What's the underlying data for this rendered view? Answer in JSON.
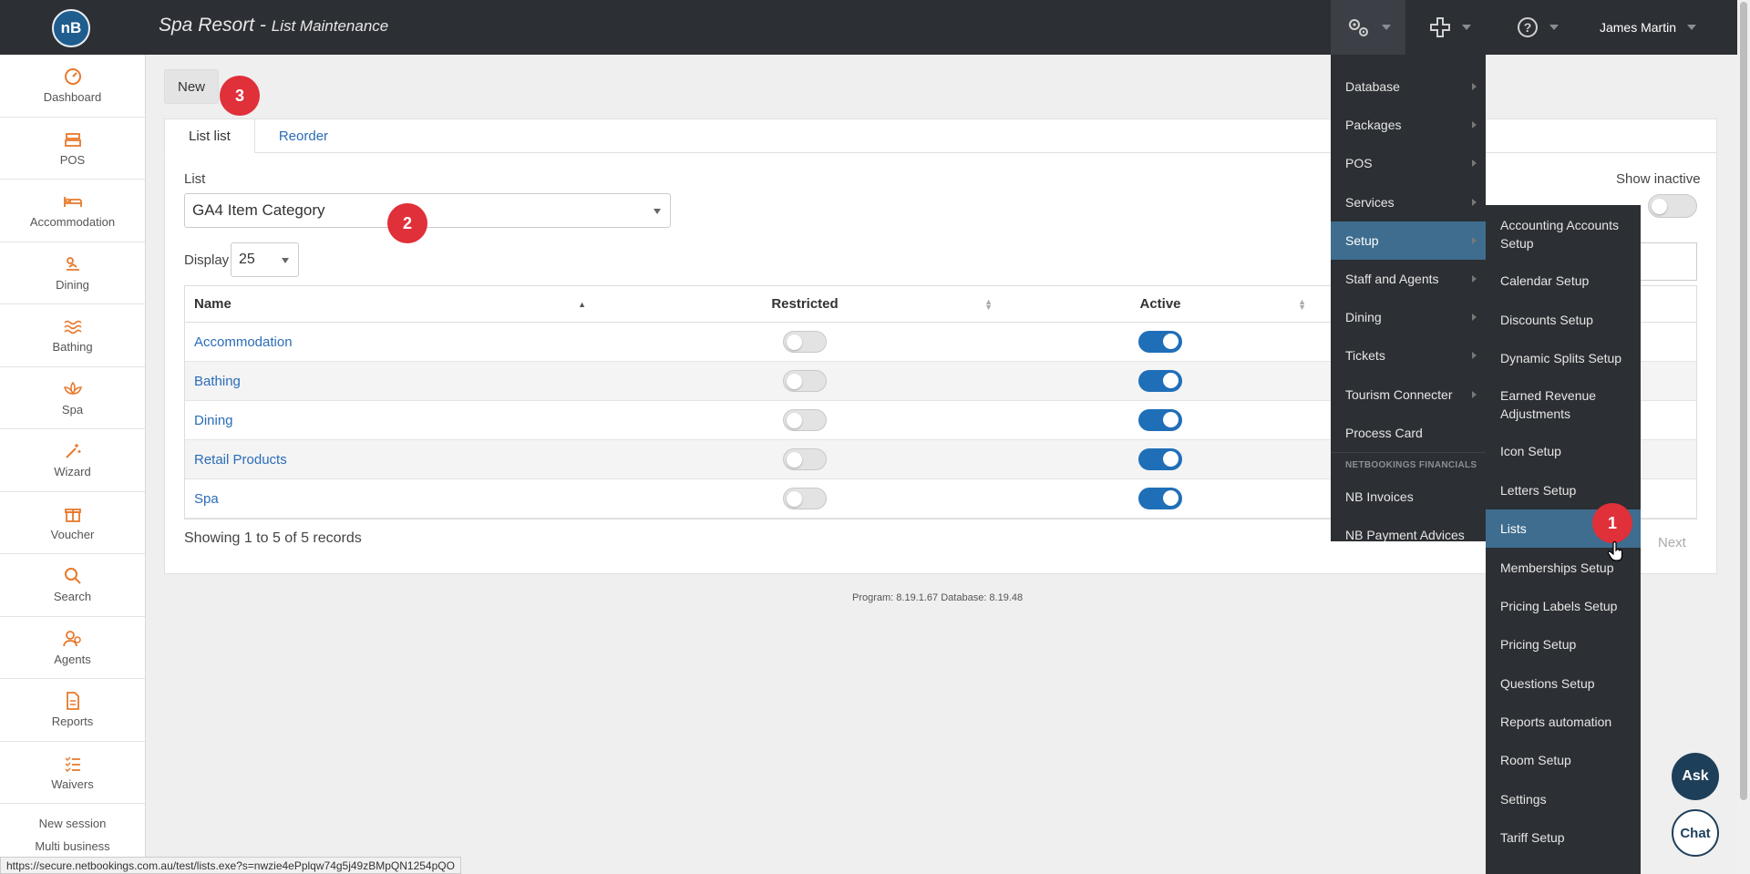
{
  "header": {
    "logo_text": "nB",
    "title": "Spa Resort",
    "title_sep": " - ",
    "subtitle": "List Maintenance",
    "user_name": "James Martin"
  },
  "sidebar": {
    "items": [
      {
        "label": "Dashboard",
        "icon": "dashboard-icon"
      },
      {
        "label": "POS",
        "icon": "register-icon"
      },
      {
        "label": "Accommodation",
        "icon": "bed-icon"
      },
      {
        "label": "Dining",
        "icon": "dining-icon"
      },
      {
        "label": "Bathing",
        "icon": "waves-icon"
      },
      {
        "label": "Spa",
        "icon": "lotus-icon"
      },
      {
        "label": "Wizard",
        "icon": "magic-wand-icon"
      },
      {
        "label": "Voucher",
        "icon": "gift-icon"
      },
      {
        "label": "Search",
        "icon": "search-icon"
      },
      {
        "label": "Agents",
        "icon": "agents-icon"
      },
      {
        "label": "Reports",
        "icon": "report-icon"
      },
      {
        "label": "Waivers",
        "icon": "checklist-icon"
      }
    ],
    "new_session": "New session",
    "multi_business": "Multi business"
  },
  "toolbar": {
    "new_label": "New"
  },
  "badges": {
    "one": "1",
    "two": "2",
    "three": "3"
  },
  "tabs": [
    {
      "label": "List list"
    },
    {
      "label": "Reorder"
    }
  ],
  "form": {
    "list_label": "List",
    "list_value": "GA4 Item Category",
    "display_label": "Display",
    "display_value": "25",
    "show_inactive_label": "Show inactive"
  },
  "table": {
    "headers": {
      "name": "Name",
      "restricted": "Restricted",
      "active": "Active"
    },
    "rows": [
      {
        "name": "Accommodation",
        "restricted": false,
        "active": true
      },
      {
        "name": "Bathing",
        "restricted": false,
        "active": true
      },
      {
        "name": "Dining",
        "restricted": false,
        "active": true
      },
      {
        "name": "Retail Products",
        "restricted": false,
        "active": true
      },
      {
        "name": "Spa",
        "restricted": false,
        "active": true
      }
    ],
    "showing": "Showing 1 to 5 of 5 records",
    "next_label": "Next"
  },
  "footer": {
    "version": "Program: 8.19.1.67 Database: 8.19.48"
  },
  "menu": {
    "items": [
      "Database",
      "Packages",
      "POS",
      "Services",
      "Setup",
      "Staff and Agents",
      "Dining",
      "Tickets",
      "Tourism Connecter",
      "Process Card"
    ],
    "section_header": "NETBOOKINGS FINANCIALS",
    "financial_items": [
      "NB Invoices",
      "NB Payment Advices"
    ],
    "selected": "Setup"
  },
  "submenu": {
    "items": [
      "Accounting Accounts Setup",
      "Calendar Setup",
      "Discounts Setup",
      "Dynamic Splits Setup",
      "Earned Revenue Adjustments",
      "Icon Setup",
      "Letters Setup",
      "Lists",
      "Memberships Setup",
      "Pricing Labels Setup",
      "Pricing Setup",
      "Questions Setup",
      "Reports automation",
      "Room Setup",
      "Settings",
      "Tariff Setup"
    ],
    "hovered": "Lists"
  },
  "assist": {
    "ask": "Ask",
    "chat": "Chat"
  },
  "status_url": "https://secure.netbookings.com.au/test/lists.exe?s=nwzie4ePplqw74g5j49zBMpQN1254pQO",
  "colors": {
    "accent": "#1f6fb8",
    "sidebar_icon": "#e8792b",
    "badge": "#e0303a",
    "topbar": "#2c2f33"
  }
}
